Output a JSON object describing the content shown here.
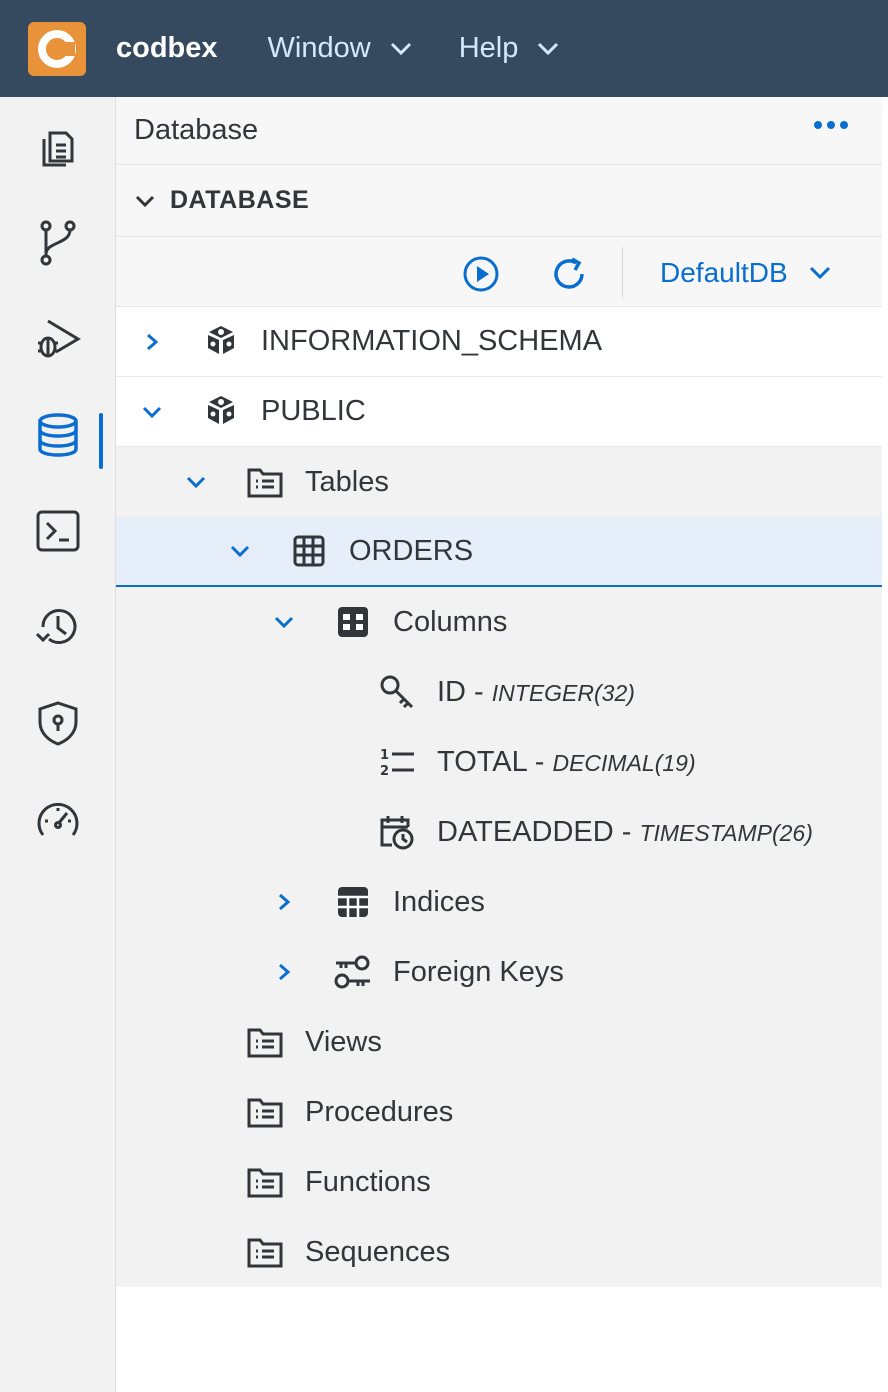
{
  "app": {
    "brand": "codbex"
  },
  "menus": [
    {
      "label": "Window"
    },
    {
      "label": "Help"
    }
  ],
  "activity_bar": [
    {
      "icon": "files-icon"
    },
    {
      "icon": "git-branch-icon"
    },
    {
      "icon": "debug-icon"
    },
    {
      "icon": "database-icon",
      "active": true
    },
    {
      "icon": "terminal-icon"
    },
    {
      "icon": "history-icon"
    },
    {
      "icon": "security-shield-icon"
    },
    {
      "icon": "gauge-icon"
    }
  ],
  "panel": {
    "title": "Database",
    "section_title": "DATABASE",
    "database_select": "DefaultDB"
  },
  "tree": {
    "schemas": [
      {
        "label": "INFORMATION_SCHEMA",
        "expanded": false
      },
      {
        "label": "PUBLIC",
        "expanded": true
      }
    ],
    "tables_label": "Tables",
    "table": {
      "label": "ORDERS"
    },
    "columns_label": "Columns",
    "columns": [
      {
        "name": "ID - ",
        "type": "INTEGER(32)"
      },
      {
        "name": "TOTAL - ",
        "type": "DECIMAL(19)"
      },
      {
        "name": "DATEADDED - ",
        "type": "TIMESTAMP(26)"
      }
    ],
    "indices_label": "Indices",
    "foreign_keys_label": "Foreign Keys",
    "folders": [
      {
        "label": "Views"
      },
      {
        "label": "Procedures"
      },
      {
        "label": "Functions"
      },
      {
        "label": "Sequences"
      }
    ]
  },
  "colors": {
    "topbar": "#354a5f",
    "accent": "#0a6ed1",
    "logo": "#e8923a"
  }
}
